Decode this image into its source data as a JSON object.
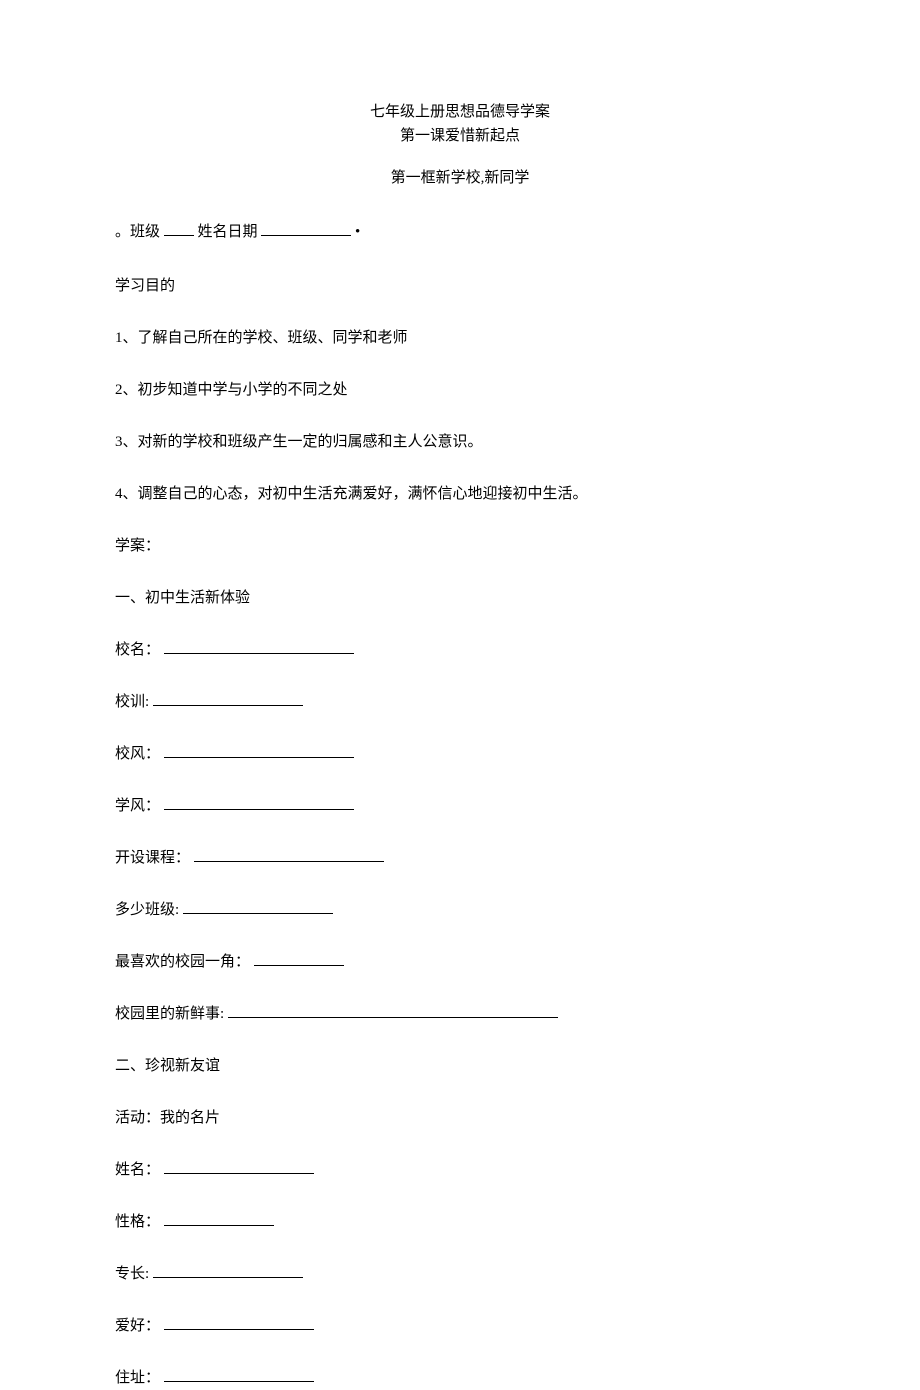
{
  "title": {
    "line1": "七年级上册思想品德导学案",
    "line2": "第一课爱惜新起点"
  },
  "subtitle": "第一框新学校,新同学",
  "class_info": {
    "prefix": "。班级",
    "name_label": "姓名日期",
    "suffix": "•"
  },
  "objectives": {
    "heading": "学习目的",
    "items": [
      "1、了解自己所在的学校、班级、同学和老师",
      "2、初步知道中学与小学的不同之处",
      "3、对新的学校和班级产生一定的归属感和主人公意识。",
      "4、调整自己的心态，对初中生活充满爱好，满怀信心地迎接初中生活。"
    ]
  },
  "study_plan": {
    "heading": "学案：",
    "section1": {
      "title": "一、初中生活新体验",
      "fields": {
        "school_name": "校名：",
        "motto": "校训:",
        "school_style": "校风：",
        "study_style": "学风：",
        "courses": "开设课程：",
        "class_count": "多少班级:",
        "favorite_corner": "最喜欢的校园一角：",
        "fresh_things": "校园里的新鲜事:"
      }
    },
    "section2": {
      "title": "二、珍视新友谊",
      "activity": "活动：我的名片",
      "fields": {
        "name": "姓名：",
        "personality": "性格：",
        "specialty": "专长:",
        "hobby": "爱好：",
        "address": "住址："
      }
    }
  }
}
